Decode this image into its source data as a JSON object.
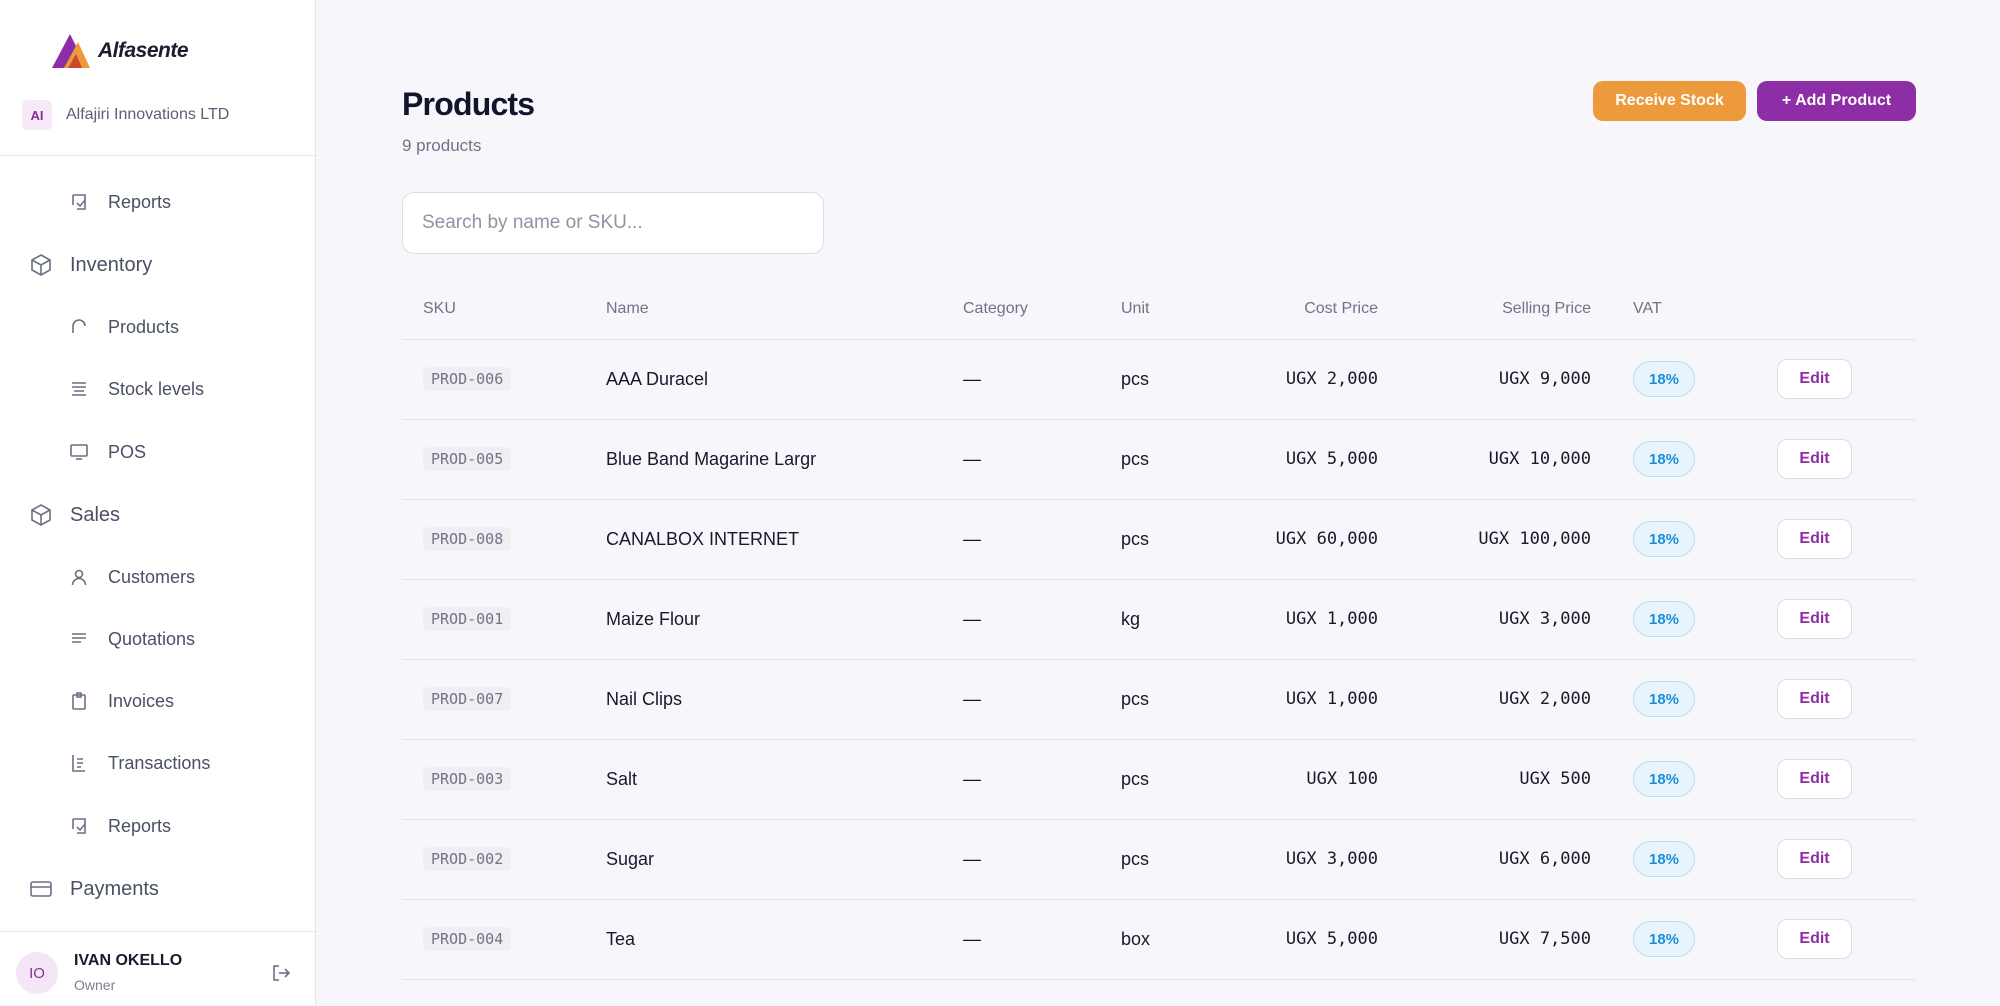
{
  "brand": {
    "name": "Alfasente",
    "org_initials": "AI",
    "org_name": "Alfajiri Innovations LTD"
  },
  "sidebar": {
    "items": [
      {
        "label": "Reports",
        "icon": "report-icon"
      },
      {
        "label": "Inventory",
        "icon": "cube-icon"
      },
      {
        "label": "Products",
        "icon": "tag-icon"
      },
      {
        "label": "Stock levels",
        "icon": "stack-icon"
      },
      {
        "label": "POS",
        "icon": "monitor-icon"
      },
      {
        "label": "Sales",
        "icon": "cube-icon"
      },
      {
        "label": "Customers",
        "icon": "user-icon"
      },
      {
        "label": "Quotations",
        "icon": "lines-icon"
      },
      {
        "label": "Invoices",
        "icon": "clipboard-icon"
      },
      {
        "label": "Transactions",
        "icon": "receipt-icon"
      },
      {
        "label": "Reports",
        "icon": "report-icon"
      },
      {
        "label": "Payments",
        "icon": "card-icon"
      }
    ]
  },
  "user": {
    "initials": "IO",
    "name": "IVAN OKELLO",
    "role": "Owner"
  },
  "page": {
    "title": "Products",
    "subtitle": "9 products",
    "receive_label": "Receive Stock",
    "add_label": "+ Add Product",
    "search_placeholder": "Search by name or SKU..."
  },
  "table": {
    "headers": {
      "sku": "SKU",
      "name": "Name",
      "category": "Category",
      "unit": "Unit",
      "cost": "Cost Price",
      "selling": "Selling Price",
      "vat": "VAT"
    },
    "rows": [
      {
        "sku": "PROD-006",
        "name": "AAA Duracel",
        "category": "—",
        "unit": "pcs",
        "cost": "UGX 2,000",
        "selling": "UGX 9,000",
        "vat": "18%",
        "action": "Edit"
      },
      {
        "sku": "PROD-005",
        "name": "Blue Band Magarine Largr",
        "category": "—",
        "unit": "pcs",
        "cost": "UGX 5,000",
        "selling": "UGX 10,000",
        "vat": "18%",
        "action": "Edit"
      },
      {
        "sku": "PROD-008",
        "name": "CANALBOX INTERNET",
        "category": "—",
        "unit": "pcs",
        "cost": "UGX 60,000",
        "selling": "UGX 100,000",
        "vat": "18%",
        "action": "Edit"
      },
      {
        "sku": "PROD-001",
        "name": "Maize Flour",
        "category": "—",
        "unit": "kg",
        "cost": "UGX 1,000",
        "selling": "UGX 3,000",
        "vat": "18%",
        "action": "Edit"
      },
      {
        "sku": "PROD-007",
        "name": "Nail Clips",
        "category": "—",
        "unit": "pcs",
        "cost": "UGX 1,000",
        "selling": "UGX 2,000",
        "vat": "18%",
        "action": "Edit"
      },
      {
        "sku": "PROD-003",
        "name": "Salt",
        "category": "—",
        "unit": "pcs",
        "cost": "UGX 100",
        "selling": "UGX 500",
        "vat": "18%",
        "action": "Edit"
      },
      {
        "sku": "PROD-002",
        "name": "Sugar",
        "category": "—",
        "unit": "pcs",
        "cost": "UGX 3,000",
        "selling": "UGX 6,000",
        "vat": "18%",
        "action": "Edit"
      },
      {
        "sku": "PROD-004",
        "name": "Tea",
        "category": "—",
        "unit": "box",
        "cost": "UGX 5,000",
        "selling": "UGX 7,500",
        "vat": "18%",
        "action": "Edit"
      }
    ]
  },
  "colors": {
    "accent": "#8d2ea6",
    "orange": "#ec9a3c",
    "vat_blue": "#1b8fd6"
  }
}
